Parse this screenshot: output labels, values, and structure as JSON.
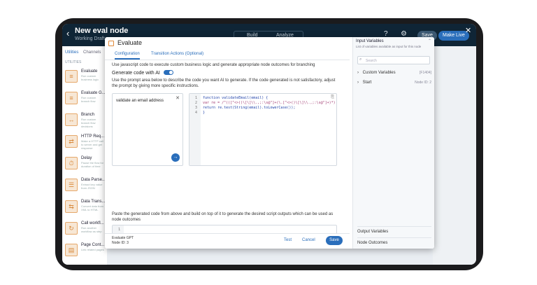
{
  "app": {
    "title": "New eval node",
    "subtitle": "Working Draft",
    "seg_build": "Build",
    "seg_analyze": "Analyze",
    "btn_gray": "Save",
    "btn_live": "Make Live"
  },
  "leftnav": {
    "tab_utilities": "Utilities",
    "tab_channels": "Channels",
    "section": "UTILITIES",
    "items": [
      {
        "name": "Evaluate",
        "desc": "Run custom business logic"
      },
      {
        "name": "Evaluate G...",
        "desc": "Run custom branch flow"
      },
      {
        "name": "Branch",
        "desc": "Run custom branch flow decisions"
      },
      {
        "name": "HTTP Req...",
        "desc": "Make a HTTP call to server and get response"
      },
      {
        "name": "Delay",
        "desc": "Pause the flow for duration of time"
      },
      {
        "name": "Data Parse...",
        "desc": "Extract key value from JSON"
      },
      {
        "name": "Data Trans...",
        "desc": "Convert data from XML to HTML"
      },
      {
        "name": "Call workfl...",
        "desc": "Run another workflow as step"
      },
      {
        "name": "Page Cont...",
        "desc": "Link related pages"
      }
    ]
  },
  "modal": {
    "title": "Evaluate",
    "tabs": [
      "Configuration",
      "Transition Actions (Optional)"
    ],
    "intro": "Use javascript code to execute custom business logic and generate appropriate node outcomes for branching",
    "gen_label": "Generate code with AI",
    "gen_desc": "Use the prompt area below to describe the code you want AI to generate. If the code generated is not satisfactory, adjust the prompt by giving more specific instructions.",
    "prompt_value": "validate an email address",
    "code_lines": [
      "function validateEmail(email) {",
      "  var re = /^(([^<>()\\[\\]\\\\.,;:\\s@\"]+(\\.[^<>()\\[\\]\\\\.,;:\\s@\"]+)*)",
      "  return re.test(String(email).toLowerCase());",
      "}"
    ],
    "paste_desc": "Paste the generated code from above and build on top of it to generate the desired script outputs which can be used as node outcomes",
    "footer_name": "Evaluate GPT",
    "footer_id": "Node ID: 3",
    "btn_test": "Test",
    "btn_cancel": "Cancel",
    "btn_save": "Save"
  },
  "right_panel": {
    "title": "Input Variables",
    "desc": "List of variables available as input for this node",
    "search_placeholder": "Search",
    "rows": [
      {
        "label": "Custom Variables",
        "meta": "[F1404]"
      },
      {
        "label": "Start",
        "meta": "Node ID: 2"
      }
    ],
    "output": "Output Variables",
    "outcomes": "Node Outcomes"
  },
  "colors": {
    "accent": "#2a6ebb",
    "topbar": "#0f2536"
  }
}
